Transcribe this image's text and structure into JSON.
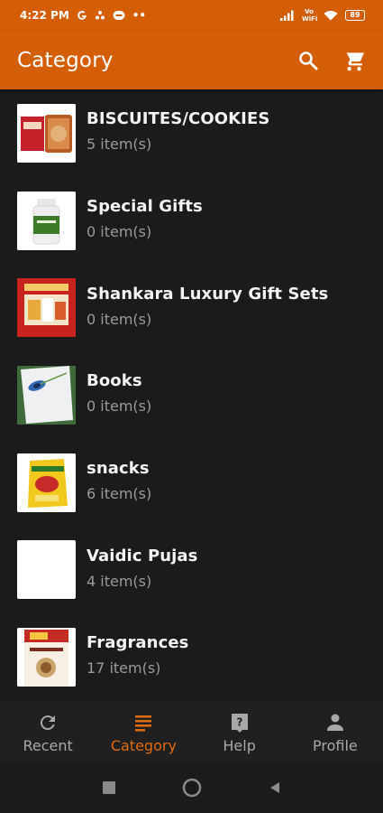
{
  "status_bar": {
    "time": "4:22 PM",
    "left_icons": [
      "google-icon",
      "notification-icon",
      "tagged-icon"
    ],
    "network_text": "Vo WiFi",
    "battery": "89"
  },
  "app_bar": {
    "title": "Category",
    "actions": [
      "search-icon",
      "cart-icon"
    ]
  },
  "categories": [
    {
      "name": "BISCUITES/COOKIES",
      "count": "5 item(s)",
      "thumb": "biscuits-thumbnail"
    },
    {
      "name": "Special Gifts",
      "count": "0 item(s)",
      "thumb": "gifts-bottle-thumbnail"
    },
    {
      "name": "Shankara Luxury Gift Sets",
      "count": "0 item(s)",
      "thumb": "gift-set-thumbnail"
    },
    {
      "name": "Books",
      "count": "0 item(s)",
      "thumb": "books-thumbnail"
    },
    {
      "name": "snacks",
      "count": "6 item(s)",
      "thumb": "snacks-thumbnail"
    },
    {
      "name": "Vaidic Pujas",
      "count": "4 item(s)",
      "thumb": "blank-thumbnail"
    },
    {
      "name": "Fragrances",
      "count": "17 item(s)",
      "thumb": "fragrances-thumbnail"
    }
  ],
  "bottom_nav": [
    {
      "label": "Recent",
      "icon": "refresh-icon",
      "active": false
    },
    {
      "label": "Category",
      "icon": "list-icon",
      "active": true
    },
    {
      "label": "Help",
      "icon": "help-icon",
      "active": false
    },
    {
      "label": "Profile",
      "icon": "person-icon",
      "active": false
    }
  ],
  "colors": {
    "accent": "#d35e05",
    "active_nav": "#e06a10",
    "background": "#1b1b1b"
  }
}
